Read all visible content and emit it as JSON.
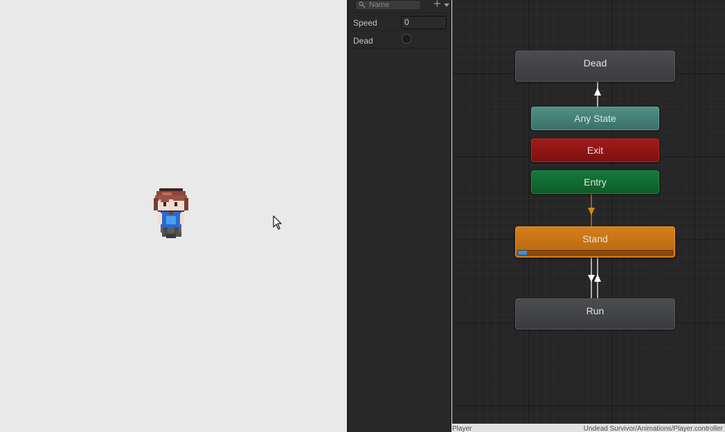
{
  "parameters": {
    "search": {
      "placeholder": "Name",
      "icon": "search-icon"
    },
    "add_icon": "plus-icon",
    "items": [
      {
        "label": "Speed",
        "type": "float",
        "value": "0"
      },
      {
        "label": "Dead",
        "type": "bool",
        "value": false
      }
    ]
  },
  "graph": {
    "nodes": {
      "dead": "Dead",
      "any_state": "Any State",
      "exit": "Exit",
      "entry": "Entry",
      "stand": "Stand",
      "run": "Run"
    },
    "stand_progress": 0.06
  },
  "status": {
    "left": "Player",
    "right": "Undead Survivor/Animations/Player.controller"
  },
  "colors": {
    "any_state": "#4e8f86",
    "exit": "#a31a1a",
    "entry": "#157a38",
    "default_state": "#d47f1c",
    "state": "#444549",
    "transition_default": "#c8780a",
    "progress": "#3a8fe0"
  }
}
